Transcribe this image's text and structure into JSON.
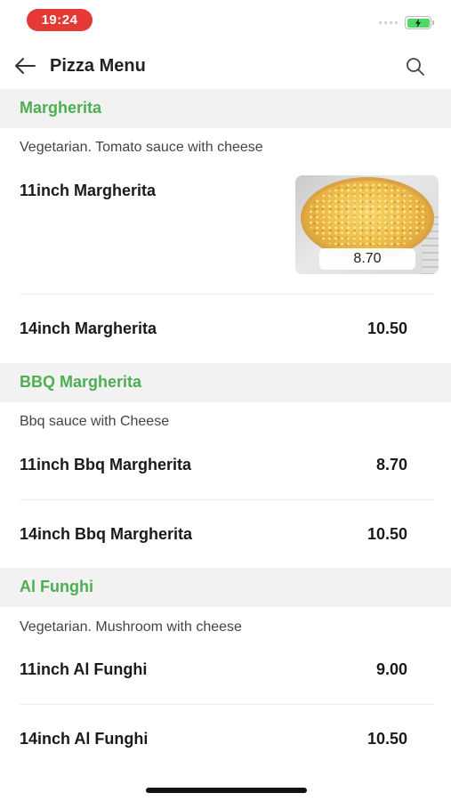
{
  "status_bar": {
    "time": "19:24",
    "battery_color": "#4cd964"
  },
  "header": {
    "title": "Pizza Menu",
    "back_icon": "arrow-left-icon",
    "search_icon": "search-icon"
  },
  "accent_color": "#4caf50",
  "sections": [
    {
      "title": "Margherita",
      "description": "Vegetarian. Tomato sauce with cheese",
      "items": [
        {
          "name": "11inch Margherita",
          "price": "8.70",
          "has_image": true
        },
        {
          "name": "14inch Margherita",
          "price": "10.50"
        }
      ]
    },
    {
      "title": "BBQ Margherita",
      "description": "Bbq sauce with Cheese",
      "items": [
        {
          "name": "11inch Bbq Margherita",
          "price": "8.70"
        },
        {
          "name": "14inch Bbq Margherita",
          "price": "10.50"
        }
      ]
    },
    {
      "title": "Al Funghi",
      "description": "Vegetarian. Mushroom with cheese",
      "items": [
        {
          "name": "11inch Al Funghi",
          "price": "9.00"
        },
        {
          "name": "14inch Al Funghi",
          "price": "10.50"
        }
      ]
    }
  ]
}
